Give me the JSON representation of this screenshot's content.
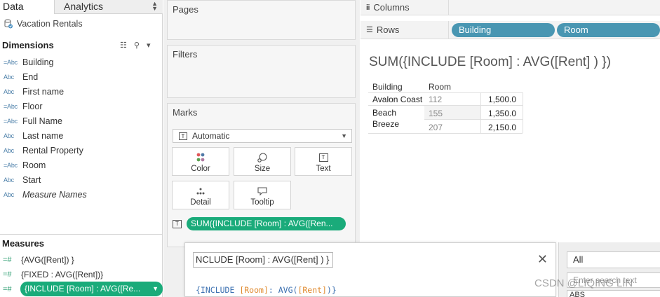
{
  "tabs": {
    "data": "Data",
    "analytics": "Analytics"
  },
  "datasource": "Vacation Rentals",
  "dimensions": {
    "title": "Dimensions",
    "items": [
      {
        "type": "=Abc",
        "name": "Building"
      },
      {
        "type": "Abc",
        "name": "End"
      },
      {
        "type": "Abc",
        "name": "First name"
      },
      {
        "type": "=Abc",
        "name": "Floor"
      },
      {
        "type": "=Abc",
        "name": "Full Name"
      },
      {
        "type": "Abc",
        "name": "Last name"
      },
      {
        "type": "Abc",
        "name": "Rental Property"
      },
      {
        "type": "=Abc",
        "name": "Room"
      },
      {
        "type": "Abc",
        "name": "Start"
      },
      {
        "type": "Abc",
        "name": "Measure Names"
      }
    ]
  },
  "measures": {
    "title": "Measures",
    "items": [
      {
        "type": "=#",
        "name": "{AVG([Rent]) }"
      },
      {
        "type": "=#",
        "name": "{FIXED : AVG([Rent])}"
      },
      {
        "type": "=#",
        "name": "{INCLUDE [Room] : AVG([Re..."
      }
    ]
  },
  "cards": {
    "pages": "Pages",
    "filters": "Filters",
    "marks": "Marks",
    "mark_type": "Automatic",
    "mark_type_icon": "T",
    "buttons": {
      "color": "Color",
      "size": "Size",
      "text": "Text",
      "detail": "Detail",
      "tooltip": "Tooltip"
    },
    "marks_pill_icon": "T",
    "marks_pill": "SUM({INCLUDE [Room] : AVG([Ren..."
  },
  "shelves": {
    "columns_label": "Columns",
    "rows_label": "Rows",
    "rows_pills": [
      "Building",
      "Room"
    ]
  },
  "view": {
    "title": "SUM({INCLUDE [Room] : AVG([Rent] ) })",
    "headers": {
      "building": "Building",
      "room": "Room"
    },
    "rows": [
      {
        "building": "Avalon Coast",
        "room": "112",
        "value": "1,500.0"
      },
      {
        "building": "Beach",
        "building2": "Breeze",
        "room": "155",
        "value": "1,350.0"
      },
      {
        "building": "",
        "room": "207",
        "value": "2,150.0"
      }
    ]
  },
  "calc_editor": {
    "name": "NCLUDE [Room] : AVG([Rent] ) }",
    "formula": {
      "open": "{INCLUDE ",
      "field1": "[Room]",
      "colon": ": ",
      "fn": "AVG",
      "paren_open": "(",
      "field2": "[Rent]",
      "close": ")}"
    }
  },
  "right_panel": {
    "select": "All",
    "search_placeholder": "Enter search text",
    "first_item": "ABS"
  },
  "watermark": "CSDN @LIQING LIN",
  "colors": {
    "row_pill": "#4996b2",
    "measure_pill": "#1aab7a",
    "dimension_type": "#4a7ea8",
    "measure_type": "#2e9e72"
  }
}
